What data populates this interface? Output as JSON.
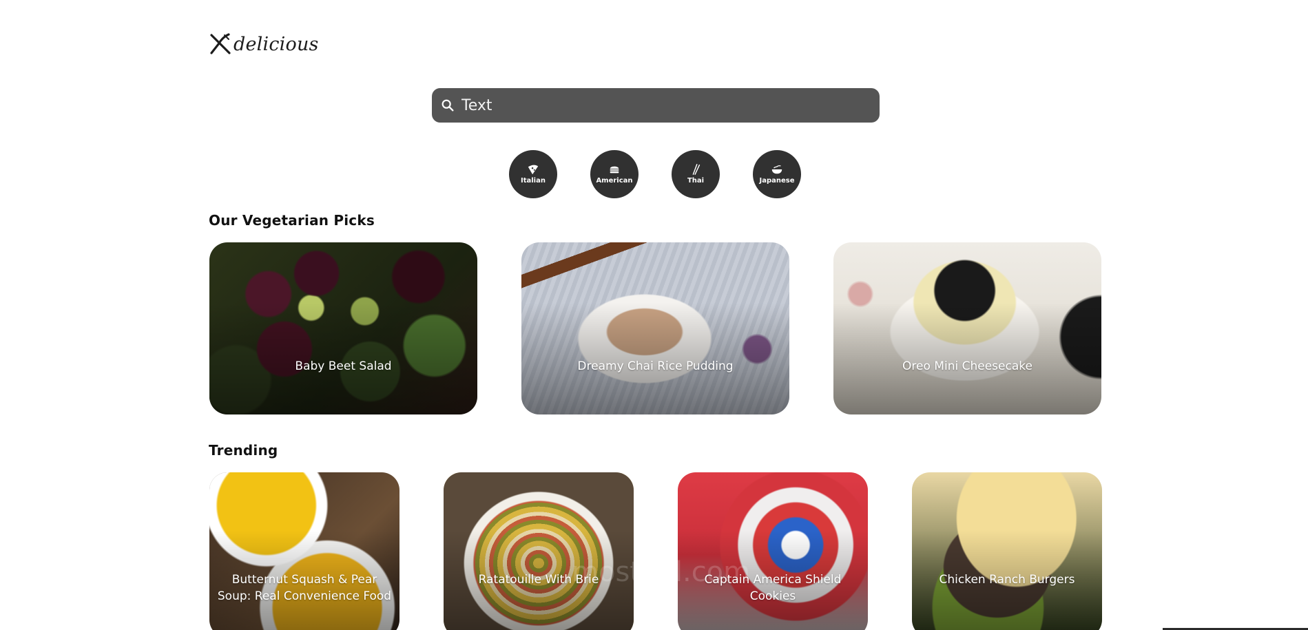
{
  "brand": {
    "name": "delicious",
    "logo_icon": "fork-knife-icon"
  },
  "search": {
    "placeholder": "Text",
    "icon": "search-icon"
  },
  "cuisines": [
    {
      "label": "Italian",
      "icon": "pizza-icon"
    },
    {
      "label": "American",
      "icon": "burger-icon"
    },
    {
      "label": "Thai",
      "icon": "chopsticks-icon"
    },
    {
      "label": "Japanese",
      "icon": "noodle-bowl-icon"
    }
  ],
  "vegetarian": {
    "title": "Our Vegetarian Picks",
    "items": [
      {
        "title": "Baby Beet Salad"
      },
      {
        "title": "Dreamy Chai Rice Pudding"
      },
      {
        "title": "Oreo Mini Cheesecake"
      }
    ]
  },
  "trending": {
    "title": "Trending",
    "items": [
      {
        "title": "Butternut Squash & Pear Soup: Real Convenience Food"
      },
      {
        "title": "Ratatouille With Brie"
      },
      {
        "title": "Captain America Shield Cookies"
      },
      {
        "title": "Chicken Ranch Burgers"
      }
    ]
  },
  "watermark": "mostaql.com",
  "colors": {
    "search_bg": "#545454",
    "cuisine_bg": "#313131",
    "text": "#111111",
    "background": "#ffffff"
  }
}
